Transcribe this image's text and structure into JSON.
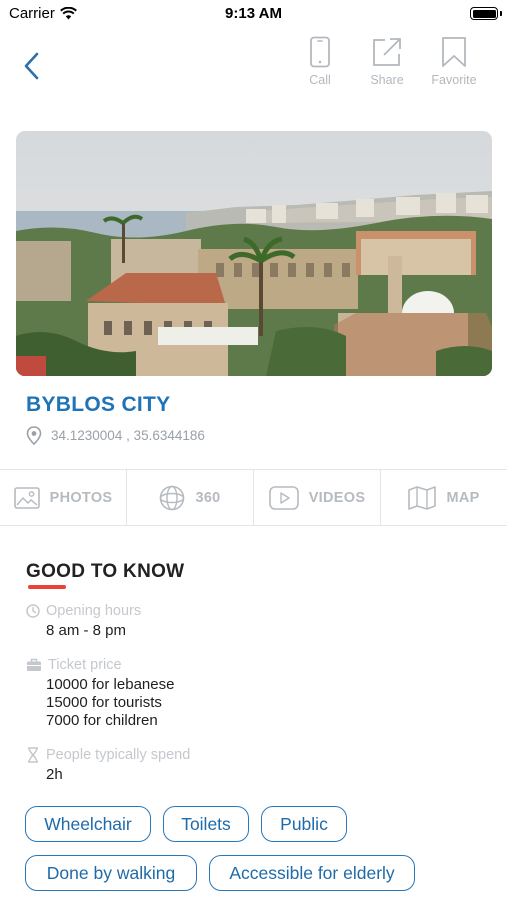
{
  "status_bar": {
    "carrier": "Carrier",
    "time": "9:13 AM"
  },
  "header": {
    "actions": [
      {
        "label": "Call",
        "icon": "phone-icon"
      },
      {
        "label": "Share",
        "icon": "share-icon"
      },
      {
        "label": "Favorite",
        "icon": "bookmark-icon"
      }
    ]
  },
  "place": {
    "name": "BYBLOS CITY",
    "coordinates": "34.1230004 , 35.6344186"
  },
  "media_tabs": [
    {
      "label": "PHOTOS",
      "icon": "photo-icon"
    },
    {
      "label": "360",
      "icon": "globe-360-icon"
    },
    {
      "label": "VIDEOS",
      "icon": "video-play-icon"
    },
    {
      "label": "MAP",
      "icon": "map-icon"
    }
  ],
  "good_to_know": {
    "title": "GOOD TO KNOW",
    "opening_hours": {
      "label": "Opening hours",
      "value": "8 am - 8 pm"
    },
    "ticket_price": {
      "label": "Ticket price",
      "lines": [
        "10000 for lebanese",
        "15000 for tourists",
        "7000 for children"
      ]
    },
    "time_spent": {
      "label": "People typically spend",
      "value": "2h"
    }
  },
  "tags": [
    "Wheelchair",
    "Toilets",
    "Public",
    "Done by walking",
    "Accessible for elderly"
  ],
  "colors": {
    "accent": "#1f73b7",
    "underline": "#e84135",
    "muted": "#b3b8bd"
  }
}
